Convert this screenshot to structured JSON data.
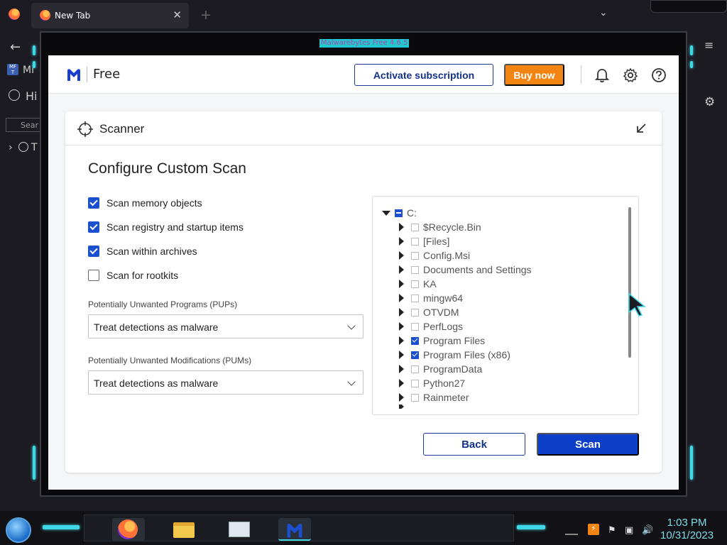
{
  "browser": {
    "tab_title": "New Tab",
    "tab_close": "✕",
    "new_tab": "+",
    "list_tabs": "⌄",
    "left_labels": [
      "Mi",
      "Hi",
      "Sear",
      "T"
    ]
  },
  "window": {
    "title": "Malwarebytes Free  4.6.5"
  },
  "header": {
    "product": "Free",
    "activate_label": "Activate subscription",
    "buy_label": "Buy now"
  },
  "scanner": {
    "title": "Scanner",
    "heading": "Configure Custom Scan",
    "options": [
      {
        "label": "Scan memory objects",
        "checked": true
      },
      {
        "label": "Scan registry and startup items",
        "checked": true
      },
      {
        "label": "Scan within archives",
        "checked": true
      },
      {
        "label": "Scan for rootkits",
        "checked": false
      }
    ],
    "pups_label": "Potentially Unwanted Programs (PUPs)",
    "pups_value": "Treat detections as malware",
    "pums_label": "Potentially Unwanted Modifications (PUMs)",
    "pums_value": "Treat detections as malware",
    "tree_root": "C:",
    "tree_items": [
      {
        "label": "$Recycle.Bin",
        "checked": false
      },
      {
        "label": "[Files]",
        "checked": false
      },
      {
        "label": "Config.Msi",
        "checked": false
      },
      {
        "label": "Documents and Settings",
        "checked": false
      },
      {
        "label": "KA",
        "checked": false
      },
      {
        "label": "mingw64",
        "checked": false
      },
      {
        "label": "OTVDM",
        "checked": false
      },
      {
        "label": "PerfLogs",
        "checked": false
      },
      {
        "label": "Program Files",
        "checked": true
      },
      {
        "label": "Program Files (x86)",
        "checked": true
      },
      {
        "label": "ProgramData",
        "checked": false
      },
      {
        "label": "Python27",
        "checked": false
      },
      {
        "label": "Rainmeter",
        "checked": false
      }
    ],
    "back_label": "Back",
    "scan_label": "Scan"
  },
  "taskbar": {
    "time": "1:03 PM",
    "date": "10/31/2023"
  },
  "colors": {
    "primary": "#0d3fc9",
    "accent_orange": "#f28412",
    "checkbox_blue": "#1a4fd0",
    "skin_cyan": "#3fd8e6"
  }
}
